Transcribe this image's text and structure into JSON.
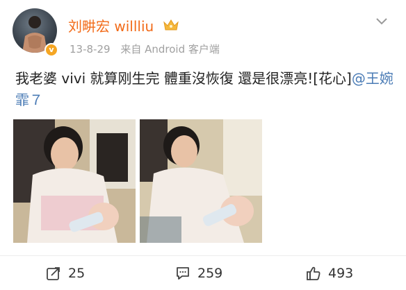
{
  "post": {
    "author": "刘畊宏 willliu",
    "verified_badge": "v",
    "timestamp": "13-8-29",
    "source": "来自 Android 客户端",
    "text_main": "我老婆 vivi 就算刚生完 體重沒恢復 還是很漂亮![花心]",
    "mention": "@王婉霏７"
  },
  "actions": {
    "repost_count": "25",
    "comment_count": "259",
    "like_count": "493"
  },
  "icons": {
    "avatar": "avatar-photo",
    "crown": "crown-icon",
    "menu": "chevron-down-icon",
    "repost": "repost-icon",
    "comment": "comment-icon",
    "like": "thumbs-up-icon"
  },
  "colors": {
    "author_name": "#f26b19",
    "mention": "#4a7bb5",
    "meta": "#a0a0a0",
    "verified": "#f5a623"
  }
}
